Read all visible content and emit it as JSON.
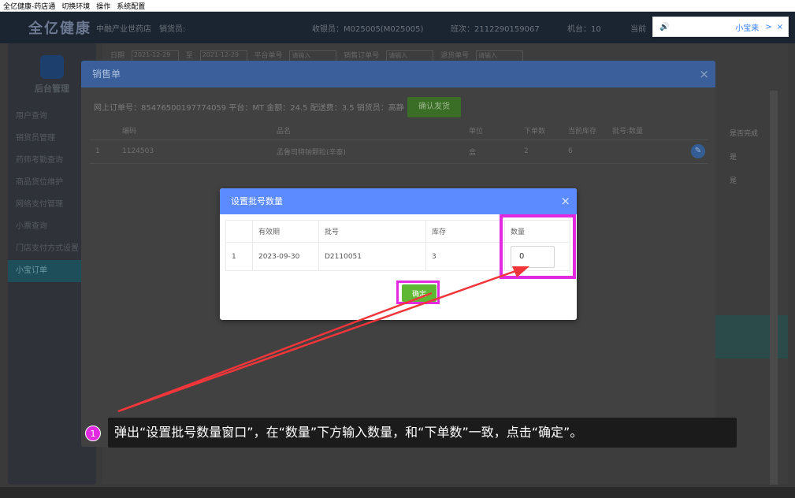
{
  "menubar": {
    "items": [
      "全亿健康-药店通",
      "切换环境",
      "操作",
      "系统配置"
    ]
  },
  "header": {
    "logo": "全亿健康",
    "store": "中融产业世药店",
    "clerk_label": "销货员:",
    "cashier": "收银员：M025005(M025005)",
    "shift": "班次：2112290159067",
    "machine": "机台：10",
    "current": "当前"
  },
  "notice": {
    "name": "小宝来",
    "chevron": ">",
    "close": "×"
  },
  "sidebar": {
    "title": "后台管理",
    "items": [
      {
        "label": "用户查询"
      },
      {
        "label": "销货员管理"
      },
      {
        "label": "药师考勤查询"
      },
      {
        "label": "商品货位维护"
      },
      {
        "label": "网络支付管理"
      },
      {
        "label": "小票查询"
      },
      {
        "label": "门店支付方式设置"
      },
      {
        "label": "小宝订单"
      }
    ]
  },
  "filter": {
    "date_label": "日期",
    "date_from": "2021-12-29",
    "date_sep": "至",
    "date_to": "2021-12-29",
    "platform_no_label": "平台单号",
    "input_placeholder": "请输入",
    "sales_no_label": "销售订单号",
    "return_no_label": "退货单号"
  },
  "right_col": {
    "header": "是否完成",
    "rows": [
      "是",
      "是"
    ]
  },
  "sales_dialog": {
    "title": "销售单",
    "close": "×",
    "order_info": "网上订单号：85476500197774059  平台：MT  金额：24.5  配送费：3.5  销货员：高静",
    "confirm_ship": "确认发货",
    "columns": [
      "",
      "编码",
      "品名",
      "单位",
      "下单数",
      "当前库存",
      "批号:数量",
      ""
    ],
    "rows": [
      {
        "idx": "1",
        "code": "1124503",
        "name": "孟鲁司特钠颗粒(辛泰)",
        "unit": "盒",
        "order_qty": "2",
        "stock": "6",
        "batch_qty": ""
      }
    ]
  },
  "batch_dialog": {
    "title": "设置批号数量",
    "close": "×",
    "columns": [
      "",
      "有效期",
      "批号",
      "库存",
      "数量"
    ],
    "rows": [
      {
        "idx": "1",
        "expiry": "2023-09-30",
        "batch": "D2110051",
        "stock": "3",
        "qty": "0"
      }
    ],
    "ok": "确定"
  },
  "caption": {
    "step": "1",
    "text": "弹出“设置批号数量窗口”，在“数量”下方输入数量，和“下单数”一致，点击“确定”。"
  },
  "colors": {
    "highlight": "#e22be0",
    "arrow": "#f0363a",
    "batch_header": "#5b8bff",
    "ok_button": "#5fb833"
  }
}
